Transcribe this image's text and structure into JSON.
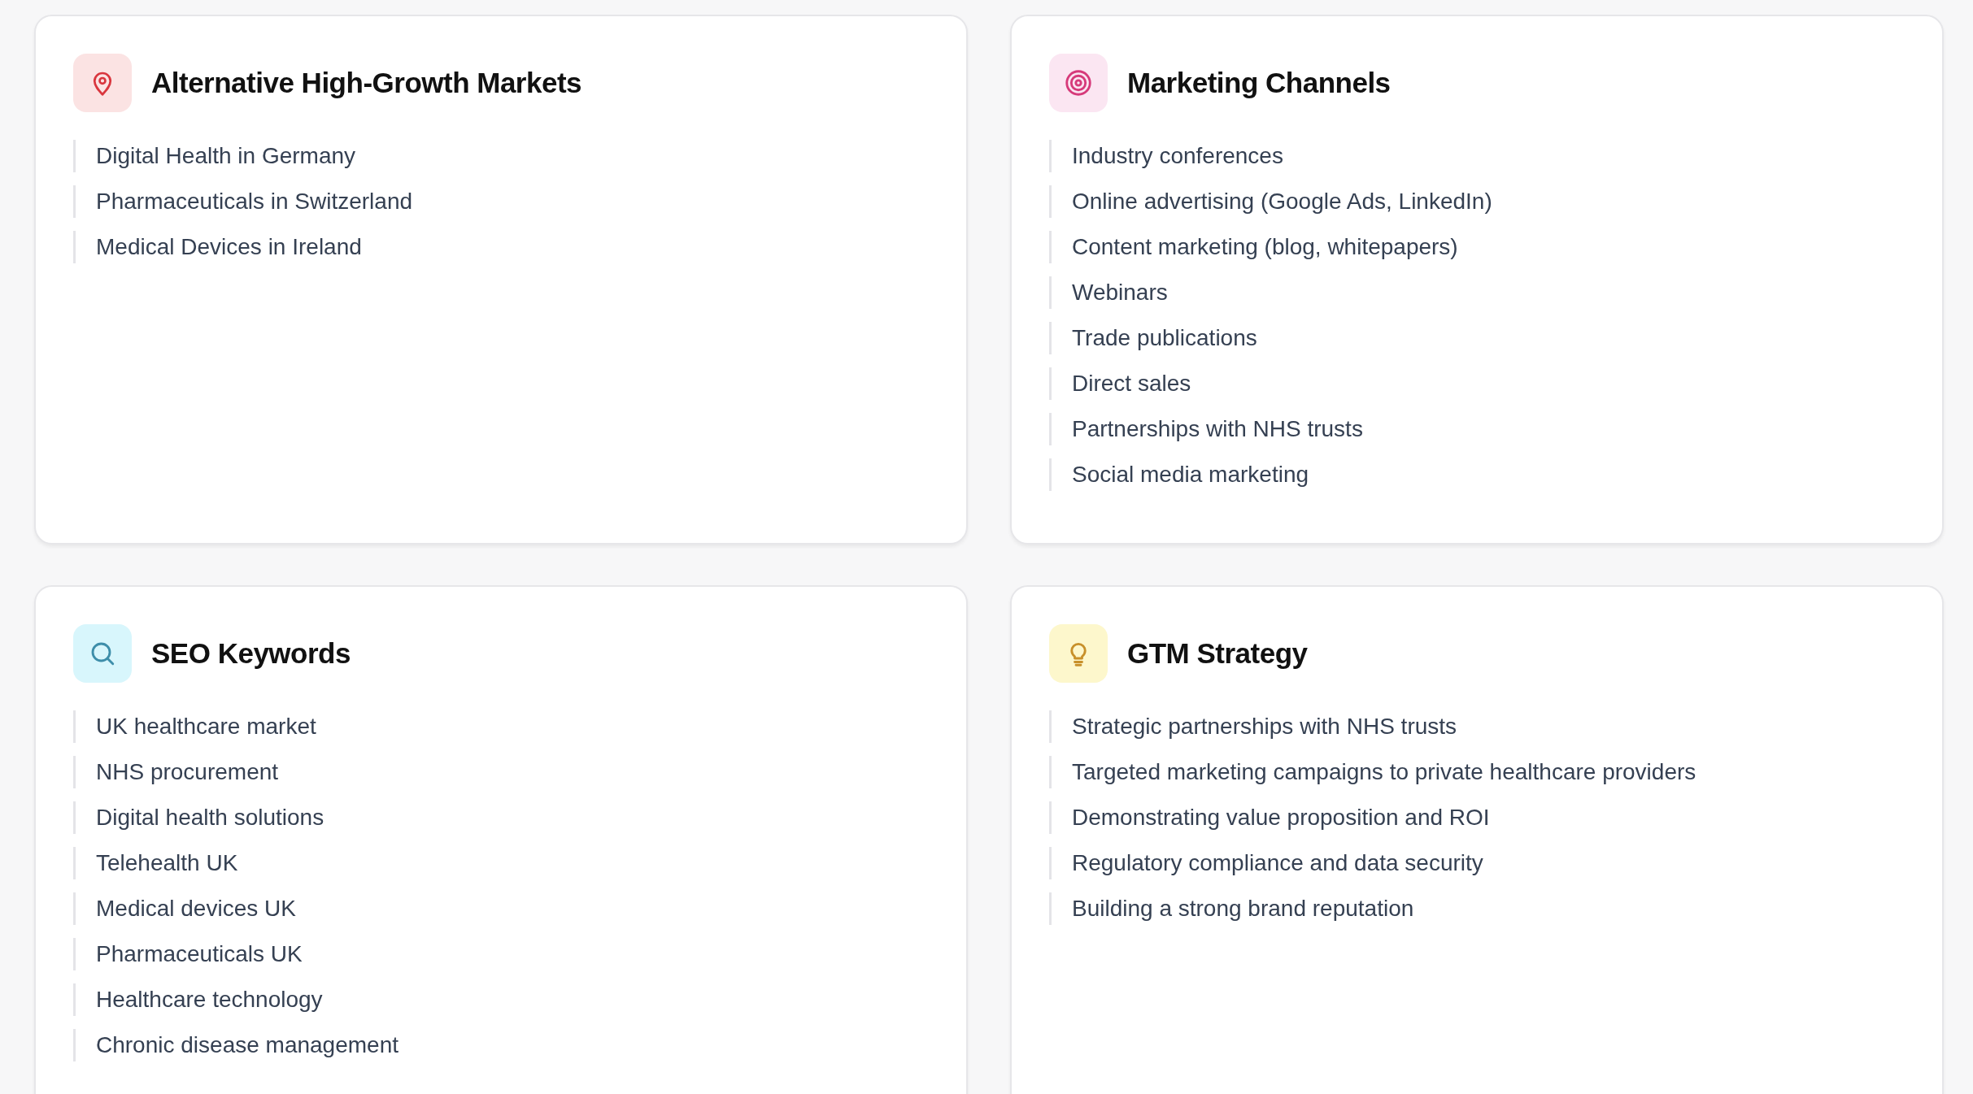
{
  "sections": [
    {
      "title": "Alternative High-Growth Markets",
      "kind": "pin",
      "items": [
        "Digital Health in Germany",
        "Pharmaceuticals in Switzerland",
        "Medical Devices in Ireland"
      ]
    },
    {
      "title": "Marketing Channels",
      "kind": "target",
      "items": [
        "Industry conferences",
        "Online advertising (Google Ads, LinkedIn)",
        "Content marketing (blog, whitepapers)",
        "Webinars",
        "Trade publications",
        "Direct sales",
        "Partnerships with NHS trusts",
        "Social media marketing"
      ]
    },
    {
      "title": "SEO Keywords",
      "kind": "search",
      "items": [
        "UK healthcare market",
        "NHS procurement",
        "Digital health solutions",
        "Telehealth UK",
        "Medical devices UK",
        "Pharmaceuticals UK",
        "Healthcare technology",
        "Chronic disease management"
      ]
    },
    {
      "title": "GTM Strategy",
      "kind": "bulb",
      "items": [
        "Strategic partnerships with NHS trusts",
        "Targeted marketing campaigns to private healthcare providers",
        "Demonstrating value proposition and ROI",
        "Regulatory compliance and data security",
        "Building a strong brand reputation"
      ]
    }
  ]
}
